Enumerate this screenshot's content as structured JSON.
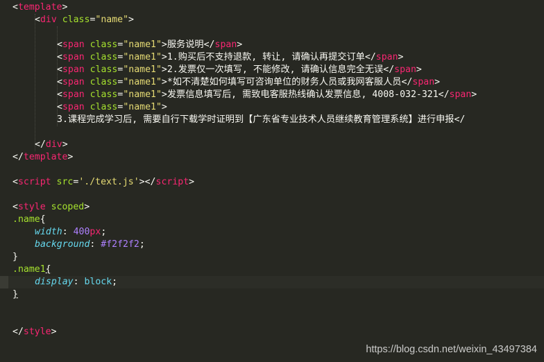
{
  "code": {
    "template_open": "template",
    "div_tag": "div",
    "class_attr": "class",
    "name_class": "\"name\"",
    "span_tag": "span",
    "name1_class": "\"name1\"",
    "span1_text": "服务说明",
    "span2_text": "1.购买后不支持退款, 转让, 请确认再提交订单",
    "span3_text": "2.发票仅一次填写, 不能修改, 请确认信息完全无误",
    "span4_text": "*如不清楚如何填写可咨询单位的财务人员或我网客服人员",
    "span5_text": "发票信息填写后, 需致电客服热线确认发票信息, 4008-032-321",
    "span6_text": "3.课程完成学习后, 需要自行下载学时证明到【广东省专业技术人员继续教育管理系统】进行申报</",
    "script_tag": "script",
    "src_attr": "src",
    "src_value": "'./text.js'",
    "style_tag": "style",
    "scoped_attr": "scoped",
    "selector_name": ".name",
    "selector_name1": ".name1",
    "prop_width": "width",
    "val_width_num": "400",
    "val_width_unit": "px",
    "prop_background": "background",
    "val_background": "#f2f2f2",
    "prop_display": "display",
    "val_display": "block"
  },
  "watermark": "https://blog.csdn.net/weixin_43497384"
}
